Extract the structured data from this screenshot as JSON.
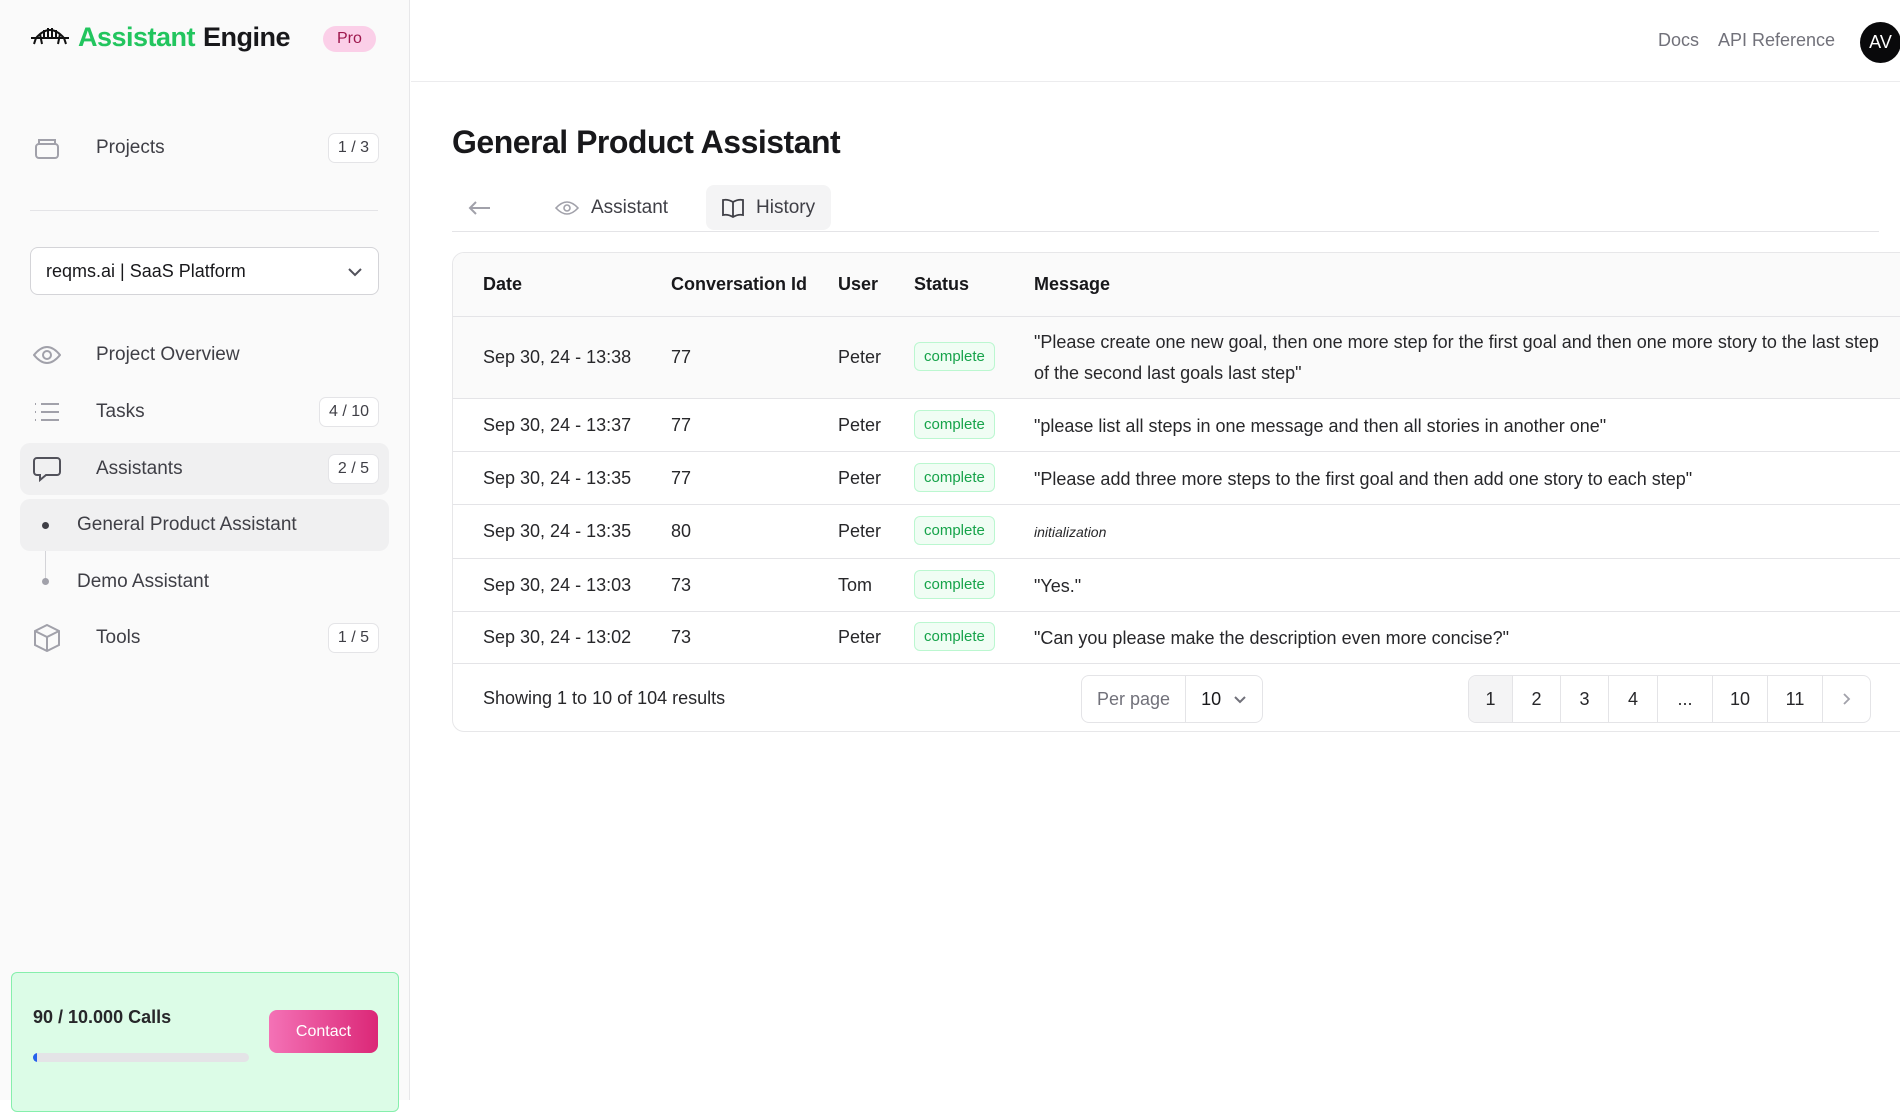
{
  "brand": {
    "name_accent": "Assistant",
    "name_rest": "Engine",
    "plan_badge": "Pro",
    "accent": "#22c55e"
  },
  "sidebar": {
    "projects": {
      "label": "Projects",
      "count": "1 / 3"
    },
    "project_select": {
      "value": "reqms.ai | SaaS Platform"
    },
    "items": [
      {
        "label": "Project Overview",
        "icon": "eye-icon"
      },
      {
        "label": "Tasks",
        "count": "4 / 10",
        "icon": "list-icon"
      },
      {
        "label": "Assistants",
        "count": "2 / 5",
        "icon": "chat-bubble-icon"
      },
      {
        "label": "Tools",
        "count": "1 / 5",
        "icon": "cube-icon"
      }
    ],
    "assistants": [
      {
        "label": "General Product Assistant"
      },
      {
        "label": "Demo Assistant"
      }
    ],
    "usage": {
      "label": "90 / 10.000 Calls",
      "fraction": 0.009,
      "contact_label": "Contact"
    }
  },
  "header": {
    "docs": "Docs",
    "api_reference": "API Reference",
    "avatar": "AV"
  },
  "page": {
    "title": "General Product Assistant"
  },
  "tabs": [
    {
      "label": "Assistant",
      "icon": "eye-icon"
    },
    {
      "label": "History",
      "icon": "book-icon",
      "active": true
    }
  ],
  "table": {
    "columns": [
      "Date",
      "Conversation Id",
      "User",
      "Status",
      "Message"
    ],
    "rows": [
      {
        "date": "Sep 30, 24 - 13:38",
        "conversation_id": "77",
        "user": "Peter",
        "status": "complete",
        "message": "\"Please create one new goal, then one more step for the first goal and then one more story to the last step of the second last goals last step\""
      },
      {
        "date": "Sep 30, 24 - 13:37",
        "conversation_id": "77",
        "user": "Peter",
        "status": "complete",
        "message": "\"please list all steps in one message and then all stories in another one\""
      },
      {
        "date": "Sep 30, 24 - 13:35",
        "conversation_id": "77",
        "user": "Peter",
        "status": "complete",
        "message": "\"Please add three more steps to the first goal and then add one story to each step\""
      },
      {
        "date": "Sep 30, 24 - 13:35",
        "conversation_id": "80",
        "user": "Peter",
        "status": "complete",
        "message": "initialization"
      },
      {
        "date": "Sep 30, 24 - 13:03",
        "conversation_id": "73",
        "user": "Tom",
        "status": "complete",
        "message": "\"Yes.\""
      },
      {
        "date": "Sep 30, 24 - 13:02",
        "conversation_id": "73",
        "user": "Peter",
        "status": "complete",
        "message": "\"Can you please make the description even more concise?\""
      }
    ],
    "footer": {
      "summary": "Showing 1 to 10 of 104 results",
      "per_page_label": "Per page",
      "per_page_value": "10",
      "pages": [
        "1",
        "2",
        "3",
        "4",
        "...",
        "10",
        "11"
      ],
      "current_page": "1"
    }
  }
}
